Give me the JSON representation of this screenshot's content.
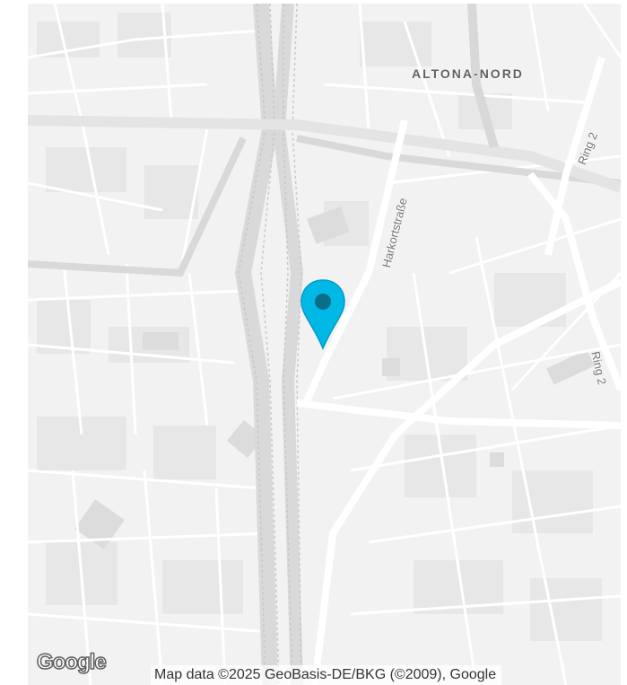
{
  "map": {
    "area_label": "ALTONA-NORD",
    "streets": {
      "harkort": "Harkortstraße",
      "ring_top": "Ring 2",
      "ring_right": "Ring 2"
    },
    "marker_color": "#00b8e6",
    "marker_dot_color": "#0a6e8a",
    "logo_text": "Google",
    "attribution": "Map data ©2025 GeoBasis-DE/BKG (©2009), Google"
  }
}
